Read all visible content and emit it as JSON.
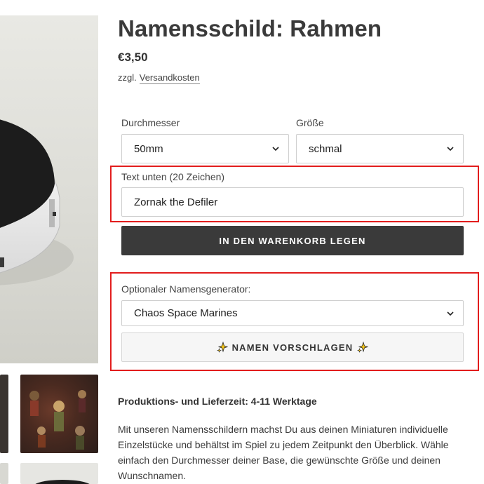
{
  "product": {
    "title": "Namensschild: Rahmen",
    "price": "€3,50",
    "tax_prefix": "zzgl.",
    "shipping_link": "Versandkosten"
  },
  "options": {
    "diameter": {
      "label": "Durchmesser",
      "value": "50mm"
    },
    "size": {
      "label": "Größe",
      "value": "schmal"
    },
    "text_bottom": {
      "label": "Text unten (20 Zeichen)",
      "value": "Zornak the Defiler"
    }
  },
  "cart_button": {
    "label": "IN DEN WARENKORB LEGEN"
  },
  "name_generator": {
    "label": "Optionaler Namensgenerator:",
    "value": "Chaos Space Marines",
    "button_label": "NAMEN VORSCHLAGEN"
  },
  "info": {
    "production_time": "Produktions- und Lieferzeit: 4-11 Werktage",
    "description": "Mit unseren Namensschildern machst Du aus deinen Miniaturen individuelle Einzelstücke und behältst im Spiel zu jedem Zeitpunkt den Überblick. Wähle einfach den Durchmesser deiner Base, die gewünschte Größe und deinen Wunschnamen."
  },
  "colors": {
    "highlight": "#e21d1d",
    "button_dark": "#3a3a3a",
    "sparkle": "#f5c518"
  },
  "icons": {
    "select_arrow": "chevron-down-icon",
    "sparkle": "sparkle-icon"
  }
}
